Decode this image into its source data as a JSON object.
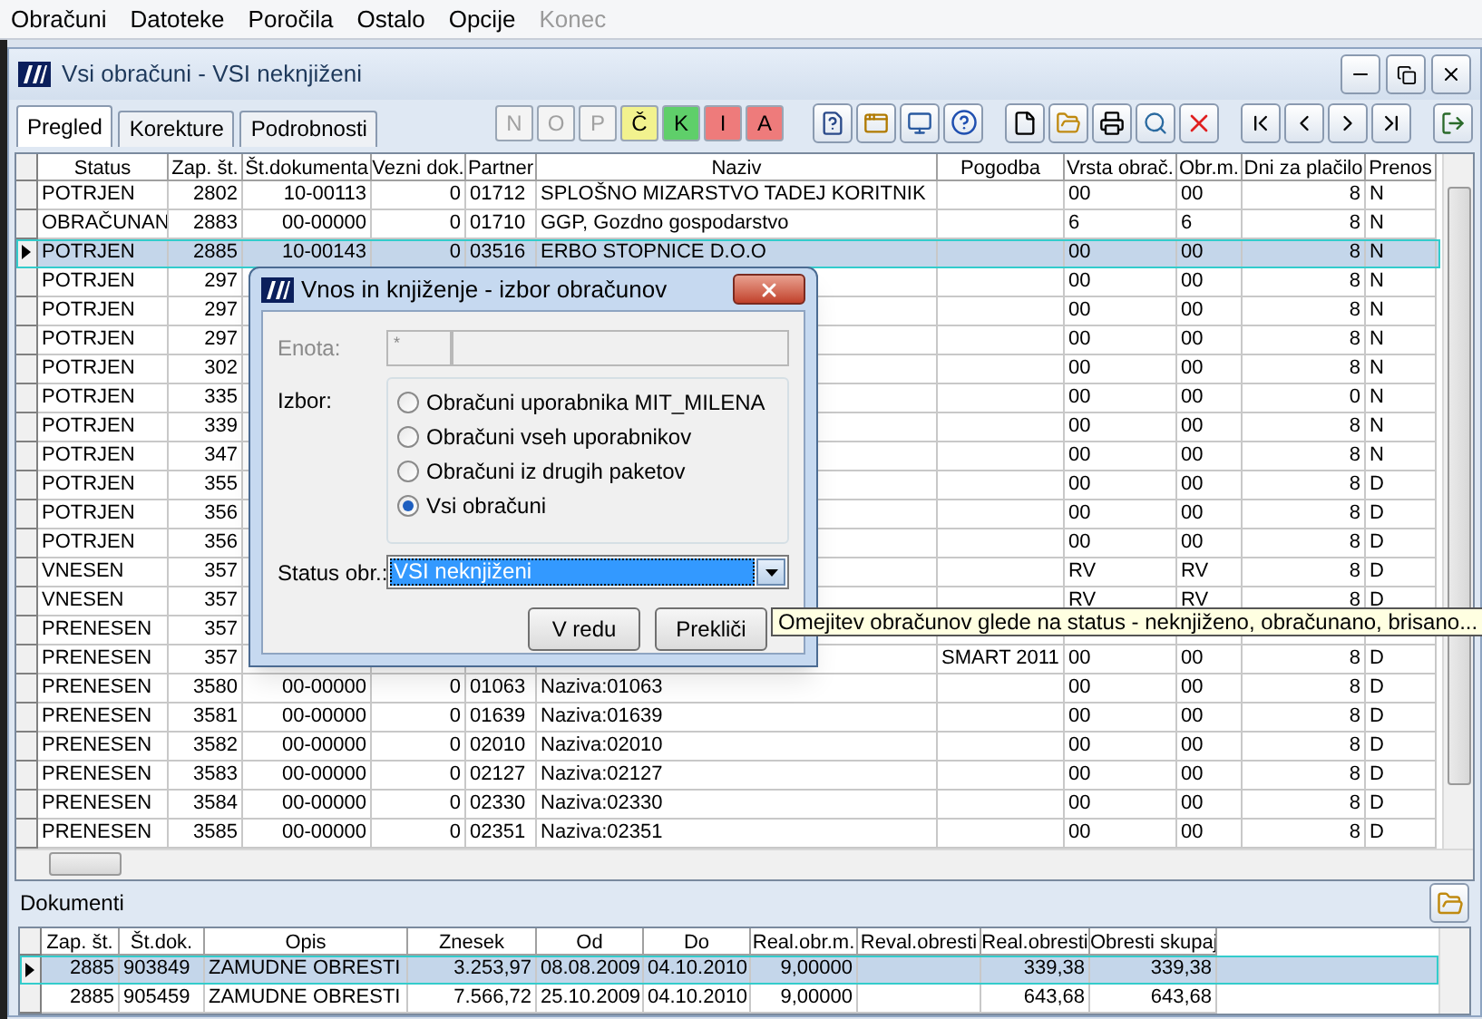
{
  "menu": [
    {
      "label": "Obračuni",
      "disabled": false
    },
    {
      "label": "Datoteke",
      "disabled": false
    },
    {
      "label": "Poročila",
      "disabled": false
    },
    {
      "label": "Ostalo",
      "disabled": false
    },
    {
      "label": "Opcije",
      "disabled": false
    },
    {
      "label": "Konec",
      "disabled": true
    }
  ],
  "window": {
    "title": "Vsi obračuni - VSI neknjiženi"
  },
  "tabs": [
    {
      "label": "Pregled",
      "selected": true
    },
    {
      "label": "Korekture",
      "selected": false
    },
    {
      "label": "Podrobnosti",
      "selected": false
    }
  ],
  "letter_buttons": [
    {
      "label": "N",
      "color": "#f4f4f4",
      "disabled": true
    },
    {
      "label": "O",
      "color": "#f4f4f4",
      "disabled": true
    },
    {
      "label": "P",
      "color": "#f4f4f4",
      "disabled": true
    },
    {
      "label": "Č",
      "color": "#f2f28e",
      "disabled": false
    },
    {
      "label": "K",
      "color": "#5fcf6a",
      "disabled": false
    },
    {
      "label": "I",
      "color": "#ee7b7b",
      "disabled": false
    },
    {
      "label": "A",
      "color": "#ee7b7b",
      "disabled": false
    }
  ],
  "table": {
    "columns": [
      "Status",
      "Zap. št.",
      "Št.dokumenta",
      "Vezni dok.",
      "Partner",
      "Naziv",
      "Pogodba",
      "Vrsta obrač.",
      "Obr.m.",
      "Dni za plačilo",
      "Prenos"
    ],
    "rows": [
      {
        "selected": false,
        "cells": [
          "POTRJEN",
          "2802",
          "10-00113",
          "0",
          "01712",
          "SPLOŠNO MIZARSTVO TADEJ KORITNIK",
          null,
          "00",
          "00",
          "8",
          "N"
        ]
      },
      {
        "selected": false,
        "cells": [
          "OBRAČUNAN",
          "2883",
          "00-00000",
          "0",
          "01710",
          "GGP, Gozdno gospodarstvo",
          null,
          "6",
          "6",
          "8",
          "N"
        ]
      },
      {
        "selected": true,
        "cells": [
          "POTRJEN",
          "2885",
          "10-00143",
          "0",
          "03516",
          "ERBO STOPNICE D.O.O",
          null,
          "00",
          "00",
          "8",
          "N"
        ]
      },
      {
        "selected": false,
        "cells": [
          "POTRJEN",
          "297",
          null,
          null,
          null,
          null,
          null,
          "00",
          "00",
          "8",
          "N"
        ]
      },
      {
        "selected": false,
        "cells": [
          "POTRJEN",
          "297",
          null,
          null,
          null,
          null,
          null,
          "00",
          "00",
          "8",
          "N"
        ]
      },
      {
        "selected": false,
        "cells": [
          "POTRJEN",
          "297",
          null,
          null,
          null,
          null,
          null,
          "00",
          "00",
          "8",
          "N"
        ]
      },
      {
        "selected": false,
        "cells": [
          "POTRJEN",
          "302",
          null,
          null,
          null,
          null,
          null,
          "00",
          "00",
          "8",
          "N"
        ]
      },
      {
        "selected": false,
        "cells": [
          "POTRJEN",
          "335",
          null,
          null,
          null,
          null,
          null,
          "00",
          "00",
          "0",
          "N"
        ]
      },
      {
        "selected": false,
        "cells": [
          "POTRJEN",
          "339",
          null,
          null,
          null,
          null,
          null,
          "00",
          "00",
          "8",
          "N"
        ]
      },
      {
        "selected": false,
        "cells": [
          "POTRJEN",
          "347",
          null,
          null,
          null,
          null,
          null,
          "00",
          "00",
          "8",
          "N"
        ]
      },
      {
        "selected": false,
        "cells": [
          "POTRJEN",
          "355",
          null,
          null,
          null,
          null,
          null,
          "00",
          "00",
          "8",
          "D"
        ]
      },
      {
        "selected": false,
        "cells": [
          "POTRJEN",
          "356",
          null,
          null,
          null,
          null,
          null,
          "00",
          "00",
          "8",
          "D"
        ]
      },
      {
        "selected": false,
        "cells": [
          "POTRJEN",
          "356",
          null,
          null,
          null,
          null,
          null,
          "00",
          "00",
          "8",
          "D"
        ]
      },
      {
        "selected": false,
        "cells": [
          "VNESEN",
          "357",
          null,
          null,
          null,
          null,
          null,
          "RV",
          "RV",
          "8",
          "D"
        ]
      },
      {
        "selected": false,
        "cells": [
          "VNESEN",
          "357",
          null,
          null,
          null,
          null,
          null,
          "RV",
          "RV",
          "8",
          "D"
        ]
      },
      {
        "selected": false,
        "cells": [
          "PRENESEN",
          "357",
          null,
          null,
          null,
          null,
          null,
          null,
          null,
          null,
          null
        ]
      },
      {
        "selected": false,
        "cells": [
          "PRENESEN",
          "357",
          null,
          null,
          null,
          null,
          "SMART 2011",
          "00",
          "00",
          "8",
          "D"
        ]
      },
      {
        "selected": false,
        "cells": [
          "PRENESEN",
          "3580",
          "00-00000",
          "0",
          "01063",
          "Naziva:01063",
          null,
          "00",
          "00",
          "8",
          "D"
        ]
      },
      {
        "selected": false,
        "cells": [
          "PRENESEN",
          "3581",
          "00-00000",
          "0",
          "01639",
          "Naziva:01639",
          null,
          "00",
          "00",
          "8",
          "D"
        ]
      },
      {
        "selected": false,
        "cells": [
          "PRENESEN",
          "3582",
          "00-00000",
          "0",
          "02010",
          "Naziva:02010",
          null,
          "00",
          "00",
          "8",
          "D"
        ]
      },
      {
        "selected": false,
        "cells": [
          "PRENESEN",
          "3583",
          "00-00000",
          "0",
          "02127",
          "Naziva:02127",
          null,
          "00",
          "00",
          "8",
          "D"
        ]
      },
      {
        "selected": false,
        "cells": [
          "PRENESEN",
          "3584",
          "00-00000",
          "0",
          "02330",
          "Naziva:02330",
          null,
          "00",
          "00",
          "8",
          "D"
        ]
      },
      {
        "selected": false,
        "cells": [
          "PRENESEN",
          "3585",
          "00-00000",
          "0",
          "02351",
          "Naziva:02351",
          null,
          "00",
          "00",
          "8",
          "D"
        ]
      }
    ]
  },
  "dialog": {
    "title": "Vnos in knjiženje - izbor obračunov",
    "enota_label": "Enota:",
    "enota_value": "*",
    "enota_disabled": true,
    "izbor_label": "Izbor:",
    "options": [
      {
        "label": "Obračuni uporabnika MIT_MILENA",
        "selected": false
      },
      {
        "label": "Obračuni vseh uporabnikov",
        "selected": false
      },
      {
        "label": "Obračuni iz drugih paketov",
        "selected": false
      },
      {
        "label": "Vsi obračuni",
        "selected": true
      }
    ],
    "status_label": "Status obr.:",
    "status_value": "VSI neknjiženi",
    "buttons": [
      "V redu",
      "Prekliči"
    ]
  },
  "tooltip": "Omejitev obračunov glede na status - neknjiženo, obračunano, brisano...",
  "documents": {
    "label": "Dokumenti",
    "columns": [
      "Zap. št.",
      "Št.dok.",
      "Opis",
      "Znesek",
      "Od",
      "Do",
      "Real.obr.m.",
      "Reval.obresti",
      "Real.obresti",
      "Obresti skupaj"
    ],
    "rows": [
      {
        "selected": true,
        "cells": [
          "2885",
          "903849",
          "ZAMUDNE OBRESTI",
          "3.253,97",
          "08.08.2009",
          "04.10.2010",
          "9,00000",
          null,
          "339,38",
          "339,38"
        ]
      },
      {
        "selected": false,
        "cells": [
          "2885",
          "905459",
          "ZAMUDNE OBRESTI",
          "7.566,72",
          "25.10.2009",
          "04.10.2010",
          "9,00000",
          null,
          "643,68",
          "643,68"
        ]
      }
    ]
  }
}
